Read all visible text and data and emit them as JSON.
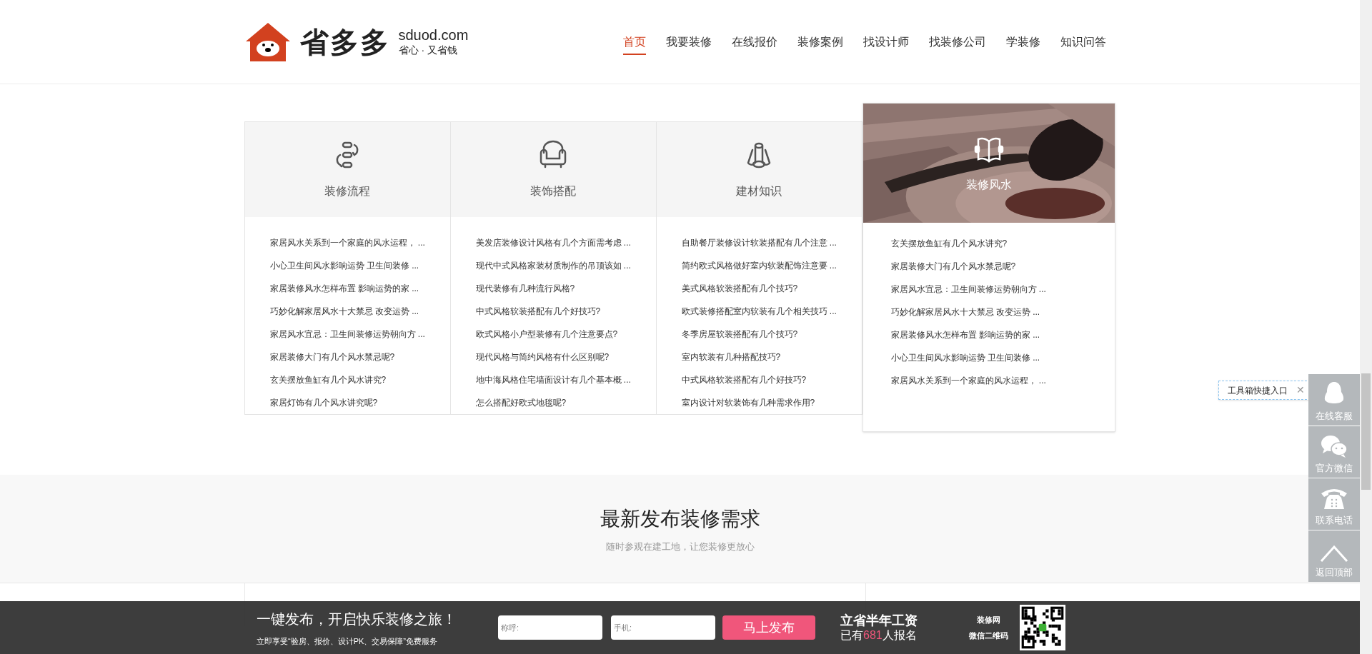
{
  "logo": {
    "name": "省多多",
    "domain": "sduod.com",
    "slogan": "省心 · 又省钱"
  },
  "nav": [
    {
      "label": "首页",
      "selected": true
    },
    {
      "label": "我要装修",
      "selected": false
    },
    {
      "label": "在线报价",
      "selected": false
    },
    {
      "label": "装修案例",
      "selected": false
    },
    {
      "label": "找设计师",
      "selected": false
    },
    {
      "label": "找装修公司",
      "selected": false
    },
    {
      "label": "学装修",
      "selected": false
    },
    {
      "label": "知识问答",
      "selected": false
    }
  ],
  "categories": [
    {
      "title": "装修流程",
      "kind": "flow",
      "featured": false,
      "links": [
        "家居风水关系到一个家庭的风水运程， ...",
        "小心卫生间风水影响运势 卫生间装修 ...",
        "家居装修风水怎样布置 影响运势的家 ...",
        "巧妙化解家居风水十大禁忌 改变运势 ...",
        "家居风水宜忌：卫生间装修运势朝向方 ...",
        "家居装修大门有几个风水禁忌呢?",
        "玄关摆放鱼缸有几个风水讲究?",
        "家居灯饰有几个风水讲究呢?"
      ]
    },
    {
      "title": "装饰搭配",
      "kind": "sofa",
      "featured": false,
      "links": [
        "美发店装修设计风格有几个方面需考虑 ...",
        "现代中式风格家装材质制作的吊顶该如 ...",
        "现代装修有几种流行风格?",
        "中式风格软装搭配有几个好技巧?",
        "欧式风格小户型装修有几个注意要点?",
        "现代风格与简约风格有什么区别呢?",
        "地中海风格住宅墙面设计有几个基本概 ...",
        "怎么搭配好欧式地毯呢?"
      ]
    },
    {
      "title": "建材知识",
      "kind": "materials",
      "featured": false,
      "links": [
        "自助餐厅装修设计软装搭配有几个注意 ...",
        "简约欧式风格做好室内软装配饰注意要 ...",
        "美式风格软装搭配有几个技巧?",
        "欧式装修搭配室内软装有几个相关技巧 ...",
        "冬季房屋软装搭配有几个技巧?",
        "室内软装有几种搭配技巧?",
        "中式风格软装搭配有几个好技巧?",
        "室内设计对软装饰有几种需求作用?"
      ]
    },
    {
      "title": "装修风水",
      "kind": "book",
      "featured": true,
      "links": [
        "玄关摆放鱼缸有几个风水讲究?",
        "家居装修大门有几个风水禁忌呢?",
        "家居风水宜忌：卫生间装修运势朝向方 ...",
        "巧妙化解家居风水十大禁忌 改变运势 ...",
        "家居装修风水怎样布置 影响运势的家 ...",
        "小心卫生间风水影响运势 卫生间装修 ...",
        "家居风水关系到一个家庭的风水运程， ..."
      ]
    }
  ],
  "requests": {
    "title": "最新发布装修需求",
    "subtitle": "随时参观在建工地，让您装修更放心"
  },
  "tooltip": {
    "text": "工具箱快捷入口",
    "close": "✕"
  },
  "side_tools": [
    {
      "label": "在线客服",
      "kind": "chat"
    },
    {
      "label": "官方微信",
      "kind": "wechat"
    },
    {
      "label": "联系电话",
      "kind": "phone"
    },
    {
      "label": "返回顶部",
      "kind": "top"
    }
  ],
  "bottom_bar": {
    "headline": "一键发布，开启快乐装修之旅！",
    "subline": "立即享受“验房、报价、设计PK、交易保障”免费服务",
    "name_placeholder": "称呼:",
    "phone_placeholder": "手机:",
    "submit": "马上发布",
    "promo": "立省半年工资",
    "count_prefix": "已有",
    "count": "681",
    "count_suffix": "人报名",
    "qr_title": "装修网",
    "qr_caption": "微信二维码"
  }
}
